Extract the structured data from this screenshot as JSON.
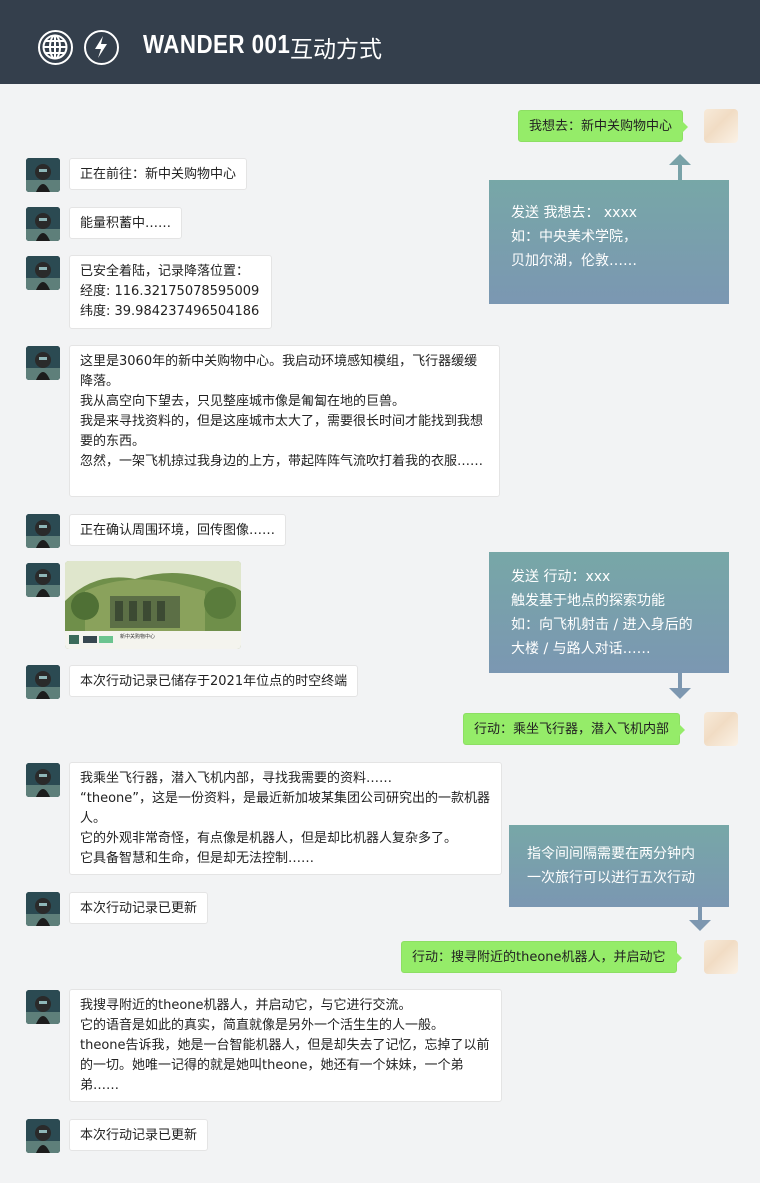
{
  "header": {
    "brand": "WANDER 001",
    "subtitle": "互动方式",
    "icons": [
      "globe-icon",
      "lightning-icon"
    ]
  },
  "messages": [
    {
      "side": "right",
      "text": "我想去：新中关购物中心"
    },
    {
      "side": "left",
      "text": "正在前往：新中关购物中心"
    },
    {
      "side": "left",
      "text": "能量积蓄中……"
    },
    {
      "side": "left",
      "text": "已安全着陆，记录降落位置：\n经度: 116.32175078595009\n纬度: 39.984237496504186"
    },
    {
      "side": "left",
      "text": "这里是3060年的新中关购物中心。我启动环境感知模组，飞行器缓缓降落。\n我从高空向下望去，只见整座城市像是匍匐在地的巨兽。\n我是来寻找资料的，但是这座城市太大了，需要很长时间才能找到我想要的东西。\n忽然，一架飞机掠过我身边的上方，带起阵阵气流吹打着我的衣服……"
    },
    {
      "side": "left",
      "text": "正在确认周围环境，回传图像……"
    },
    {
      "side": "left",
      "type": "image",
      "caption": "新中关购物中心"
    },
    {
      "side": "left",
      "text": "本次行动记录已储存于2021年位点的时空终端"
    },
    {
      "side": "right",
      "text": "行动：乘坐飞行器，潜入飞机内部"
    },
    {
      "side": "left",
      "text": "我乘坐飞行器，潜入飞机内部，寻找我需要的资料……\n“theone”，这是一份资料，是最近新加坡某集团公司研究出的一款机器人。\n它的外观非常奇怪，有点像是机器人，但是却比机器人复杂多了。\n它具备智慧和生命，但是却无法控制……"
    },
    {
      "side": "left",
      "text": "本次行动记录已更新"
    },
    {
      "side": "right",
      "text": "行动：搜寻附近的theone机器人，并启动它"
    },
    {
      "side": "left",
      "text": "我搜寻附近的theone机器人，并启动它，与它进行交流。\n它的语音是如此的真实，简直就像是另外一个活生生的人一般。\ntheone告诉我，她是一台智能机器人，但是却失去了记忆，忘掉了以前的一切。她唯一记得的就是她叫theone，她还有一个妹妹，一个弟弟……"
    },
    {
      "side": "left",
      "text": "本次行动记录已更新"
    }
  ],
  "notes": [
    {
      "text": "发送 我想去： xxxx\n如：中央美术学院，\n贝加尔湖，伦敦……"
    },
    {
      "text": "发送 行动：xxx\n触发基于地点的探索功能\n如：向飞机射击 / 进入身后的\n大楼 / 与路人对话……"
    },
    {
      "text": "指令间间隔需要在两分钟内\n一次旅行可以进行五次行动"
    }
  ],
  "colors": {
    "header_bg": "#343f4c",
    "bubble_green": "#95ec69",
    "note_top": "#77a7a7",
    "note_bottom": "#7b97b2",
    "page_bg": "#f2f3f4"
  }
}
